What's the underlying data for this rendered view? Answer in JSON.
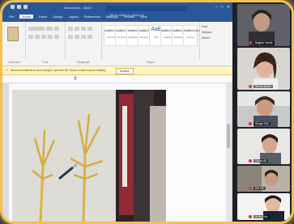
{
  "window": {
    "title": "Document1 - Word",
    "search_placeholder": "Tell me what you want to do",
    "tabs": [
      "File",
      "Home",
      "Insert",
      "Design",
      "Layout",
      "References",
      "Mailings",
      "Review",
      "View"
    ]
  },
  "ribbon": {
    "groups": {
      "clipboard": "Clipboard",
      "font": "Font",
      "paragraph": "Paragraph",
      "styles": "Styles",
      "editing": "Editing"
    },
    "styles": [
      {
        "sample": "AaBbCcDc",
        "name": "Normal"
      },
      {
        "sample": "AaBbCcDc",
        "name": "No Spac..."
      },
      {
        "sample": "AaBbCc",
        "name": "Heading 1"
      },
      {
        "sample": "AaBbCc",
        "name": "Heading 2"
      },
      {
        "sample": "AaB",
        "name": "Title"
      },
      {
        "sample": "AaBbCcD",
        "name": "Subtitle"
      },
      {
        "sample": "AaBbCcDc",
        "name": "Emphasis"
      },
      {
        "sample": "AaBbCcDc",
        "name": "Strong"
      }
    ],
    "editing": {
      "find": "Find",
      "replace": "Replace",
      "select": "Select"
    }
  },
  "message_bar": {
    "text": "Word encountered an error trying to open the file. Some content may be missing.",
    "button": "Dismiss"
  },
  "participants": [
    {
      "name": "Bağlan Serde"
    },
    {
      "name": "Simay Aydın"
    },
    {
      "name": "Simge Efe"
    },
    {
      "name": "Deniz Ak"
    },
    {
      "name": "Elif Öz"
    },
    {
      "name": "Arda Kılıç"
    }
  ],
  "colors": {
    "titlebar": "#2b579a",
    "frame_glow": "#f2c14e",
    "message_bar": "#fff4c2"
  }
}
